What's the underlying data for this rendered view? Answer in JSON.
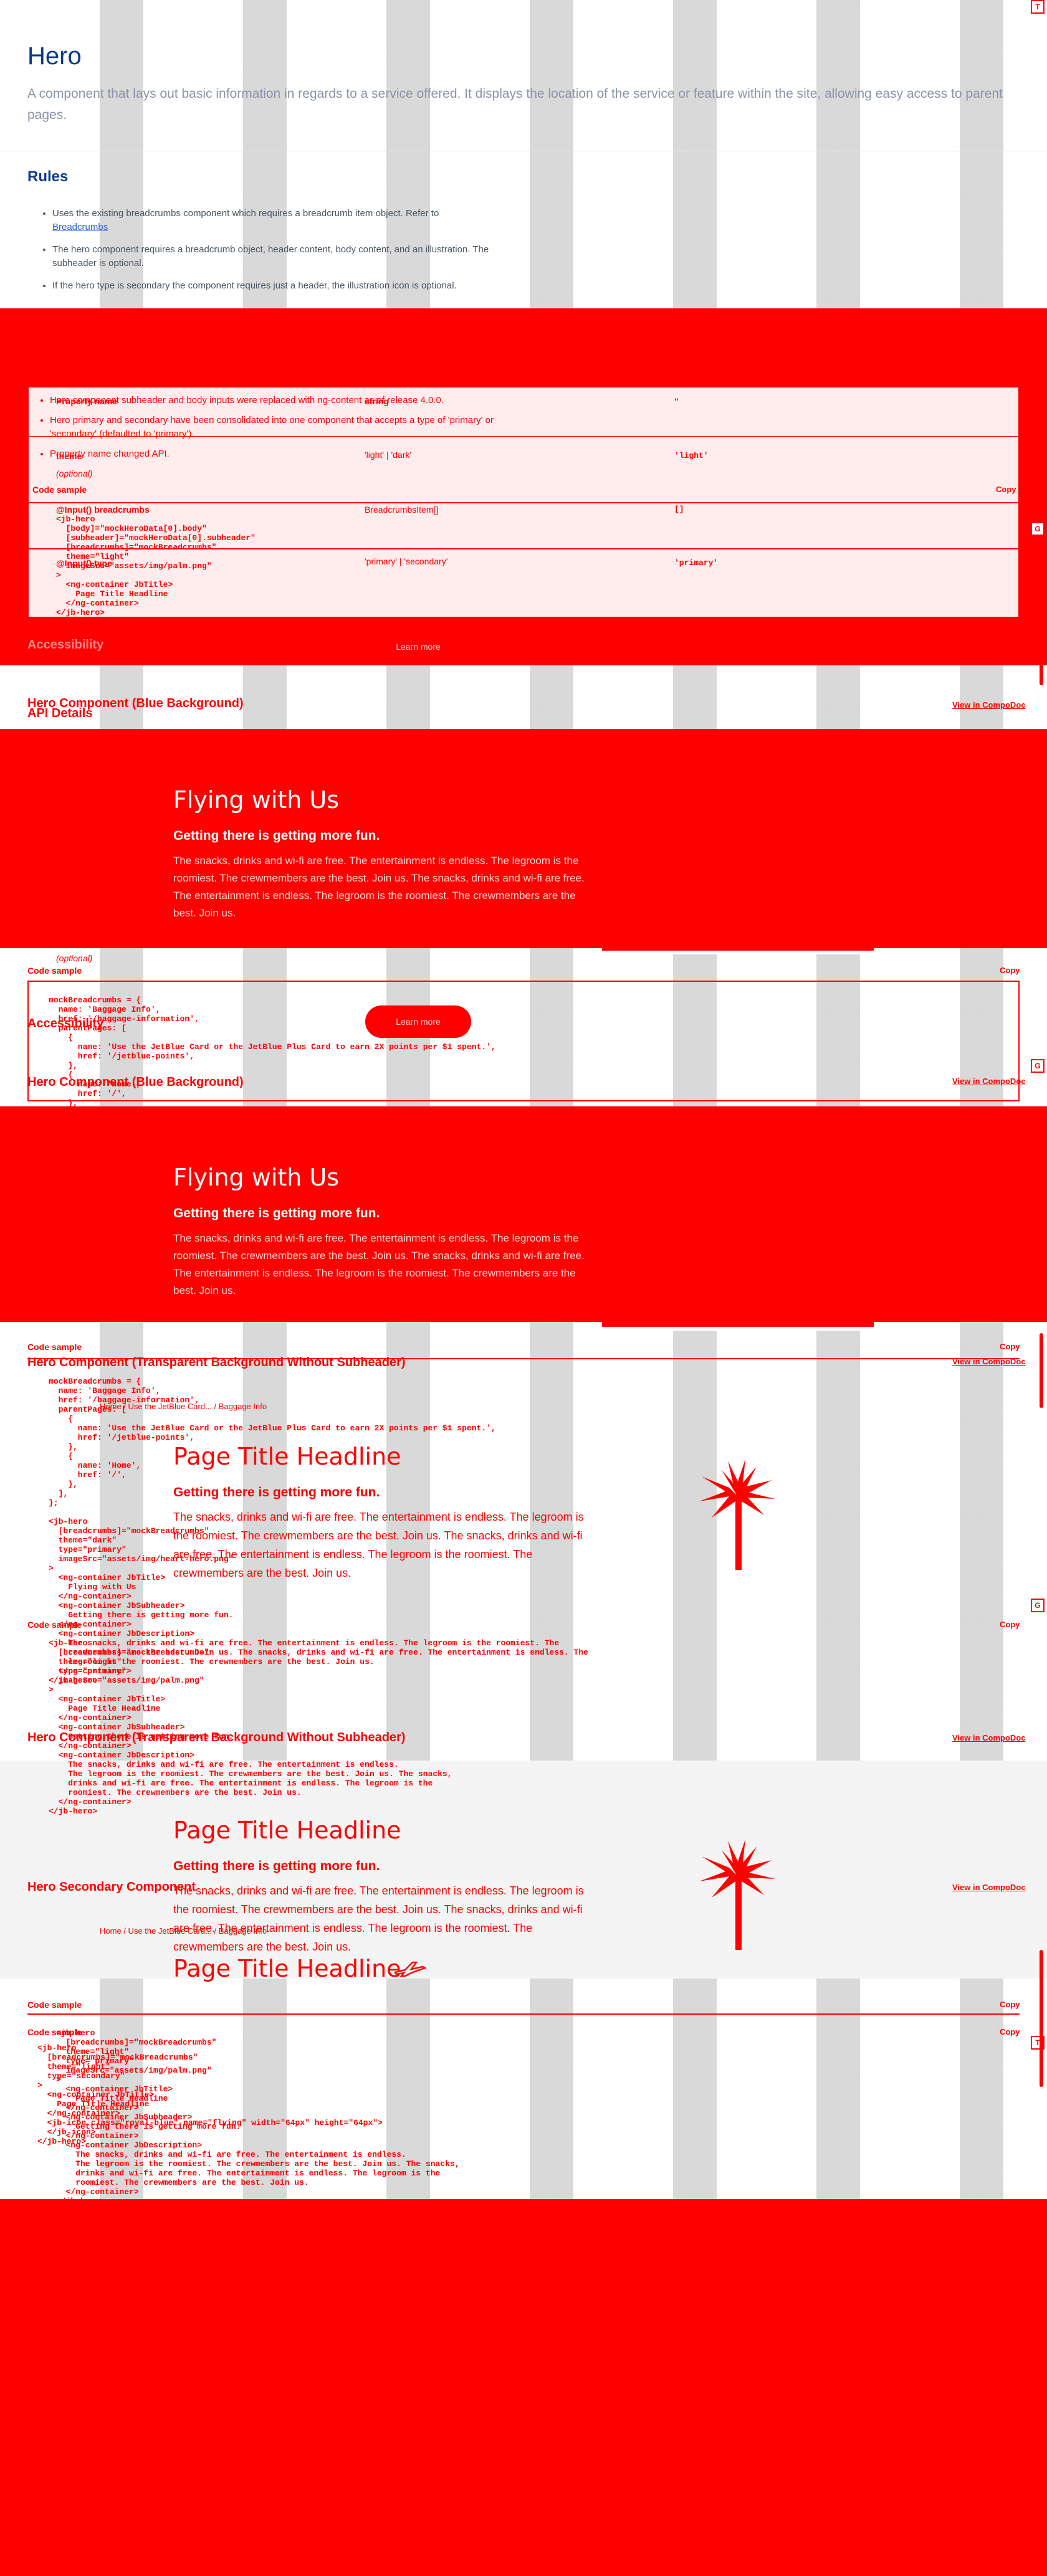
{
  "page": {
    "title": "Hero",
    "description": "A component that lays out basic information in regards to a service offered. It displays the location of the service or feature within the site, allowing easy access to parent pages."
  },
  "rules": {
    "heading": "Rules",
    "item1_pre": "Uses the existing breadcrumbs component which requires a breadcrumb item object. Refer to",
    "item1_link": "Breadcrumbs",
    "item2": "The hero component requires a breadcrumb object, header content, body content, and an illustration. The subheader is optional.",
    "item3": "If the hero type is secondary the component requires just a header, the illustration icon is optional."
  },
  "notes": {
    "note1": "Hero component subheader and body inputs were replaced with ng-content as of release 4.0.0.",
    "note2": "Hero primary and secondary have been consolidated into one component that accepts a type of 'primary' or 'secondary' (defaulted to 'primary').",
    "note3": "Property name changed API."
  },
  "api": {
    "heading": "API Details",
    "rows": [
      {
        "name": "Property name",
        "type": "string",
        "default": "''"
      },
      {
        "name": "theme",
        "type": "'light' | 'dark'",
        "default": "'light'"
      },
      {
        "name": "breadcrumbs",
        "type": "BreadcrumbsItem[]",
        "default": "[]"
      },
      {
        "name": "type",
        "type": "'primary' | 'secondary'",
        "default": "'primary'"
      }
    ],
    "optional": "(optional)",
    "input_label": "@Input()"
  },
  "code_sample_label": "Code sample",
  "copy_label": "Copy",
  "view_label": "View in CompoDoc",
  "accessibility": "Accessibility",
  "button_label": "Learn more",
  "code1": "<jb-hero\n  [body]=\"mockHeroData[0].body\"\n  [subheader]=\"mockHeroData[0].subheader\"\n  [breadcrumbs]=\"mockBreadcrumbs\"\n  theme=\"light\"\n  imageSrc=\"assets/img/palm.png\"\n>\n  <ng-container JbTitle>\n    Page Title Headline\n  </ng-container>\n</jb-hero>",
  "section_blue": "Hero Component (Blue Background)",
  "section_transparent": "Hero Component (Transparent Background Without Subheader)",
  "section_secondary": "Hero Secondary Component",
  "hero_blue": {
    "title": "Flying with Us",
    "subheader": "Getting there is getting more fun.",
    "body": "The snacks, drinks and wi-fi are free. The entertainment is endless. The legroom is the roomiest. The crewmembers are the best. Join us. The snacks, drinks and wi-fi are free. The entertainment is endless. The legroom is the roomiest. The crewmembers are the best. Join us."
  },
  "code2": "mockBreadcrumbs = {\n  name: 'Baggage Info',\n  href: '/baggage-information',\n  parentPages: [\n    {\n      name: 'Use the JetBlue Card or the JetBlue Plus Card to earn 2X points per $1 spent.',\n      href: '/jetblue-points',\n    },\n    {\n      name: 'Home',\n      href: '/',\n    },\n  ],\n};",
  "code3": "mockBreadcrumbs = {\n  name: 'Baggage Info',\n  href: '/baggage-information',\n  parentPages: [\n    {\n      name: 'Use the JetBlue Card or the JetBlue Plus Card to earn 2X points per $1 spent.',\n      href: '/jetblue-points',\n    },\n    {\n      name: 'Home',\n      href: '/',\n    },\n  ],\n};\n\n<jb-hero\n  [breadcrumbs]=\"mockBreadcrumbs\"\n  theme=\"dark\"\n  type=\"primary\"\n  imageSrc=\"assets/img/heart-hero.png\"\n>\n  <ng-container JbTitle>\n    Flying with Us\n  </ng-container>\n  <ng-container JbSubheader>\n    Getting there is getting more fun.\n  </ng-container>\n  <ng-container JbDescription>\n    The snacks, drinks and wi-fi are free. The entertainment is endless. The legroom is the roomiest. The\n    crewmembers are the best. Join us. The snacks, drinks and wi-fi are free. The entertainment is endless. The\n    legroom is the roomiest. The crewmembers are the best. Join us.\n  </ng-container>\n</jb-hero>",
  "hero_light": {
    "crumbs": "Home  /  Use the JetBlue Card...  /  Baggage Info",
    "title": "Page Title Headline",
    "subheader": "Getting there is getting more fun.",
    "body": "The snacks, drinks and wi-fi are free. The entertainment is endless. The legroom is the roomiest. The crewmembers are the best. Join us. The snacks, drinks and wi-fi are free. The entertainment is endless. The legroom is the roomiest. The crewmembers are the best. Join us."
  },
  "code4": "<jb-hero\n  [breadcrumbs]=\"mockBreadcrumbs\"\n  theme=\"light\"\n  type=\"primary\"\n  imageSrc=\"assets/img/palm.png\"\n>\n  <ng-container JbTitle>\n    Page Title Headline\n  </ng-container>\n  <ng-container JbSubheader>\n    Getting there is getting more fun.\n  </ng-container>\n  <ng-container JbDescription>\n    The snacks, drinks and wi-fi are free. The entertainment is endless.\n    The legroom is the roomiest. The crewmembers are the best. Join us. The snacks,\n    drinks and wi-fi are free. The entertainment is endless. The legroom is the\n    roomiest. The crewmembers are the best. Join us.\n  </ng-container>\n</jb-hero>",
  "hero_transparent": {
    "title": "Page Title Headline",
    "subheader": "Getting there is getting more fun.",
    "body": "The snacks, drinks and wi-fi are free. The entertainment is endless. The legroom is the roomiest. The crewmembers are the best. Join us. The snacks, drinks and wi-fi are free. The entertainment is endless. The legroom is the roomiest. The crewmembers are the best. Join us."
  },
  "hero_secondary": {
    "crumbs": "Home  /  Use the JetBlue Card...  /  Baggage Info",
    "title": "Page Title Headline"
  },
  "code5": "<jb-hero\n  [breadcrumbs]=\"mockBreadcrumbs\"\n  theme=\"light\"\n  type=\"secondary\"\n>\n  <ng-container JbTitle>\n    Page Title Headline\n  </ng-container>\n  <jb-icon class=\"royal-blue\" name=\"flying\" width=\"64px\" height=\"64px\">\n  </jb-icon>\n</jb-hero>",
  "code6": "<jb-hero\n  [breadcrumbs]=\"mockBreadcrumbs\"\n  theme=\"light\"\n  type=\"primary\"\n  imageSrc=\"assets/img/palm.png\"\n>\n  <ng-container JbTitle>\n    Page Title Headline\n  </ng-container>\n  <ng-container JbSubheader>\n    Getting there is getting more fun.\n  </ng-container>\n  <ng-container JbDescription>\n    The snacks, drinks and wi-fi are free. The entertainment is endless.\n    The legroom is the roomiest. The crewmembers are the best. Join us. The snacks,\n    drinks and wi-fi are free. The entertainment is endless. The legroom is the\n    roomiest. The crewmembers are the best. Join us.\n  </ng-container>\n</jb-hero>",
  "colors": {
    "accent": "#ff0000",
    "title": "#0b3b8c",
    "muted": "#8a94a6",
    "link": "#2b5fd9"
  }
}
